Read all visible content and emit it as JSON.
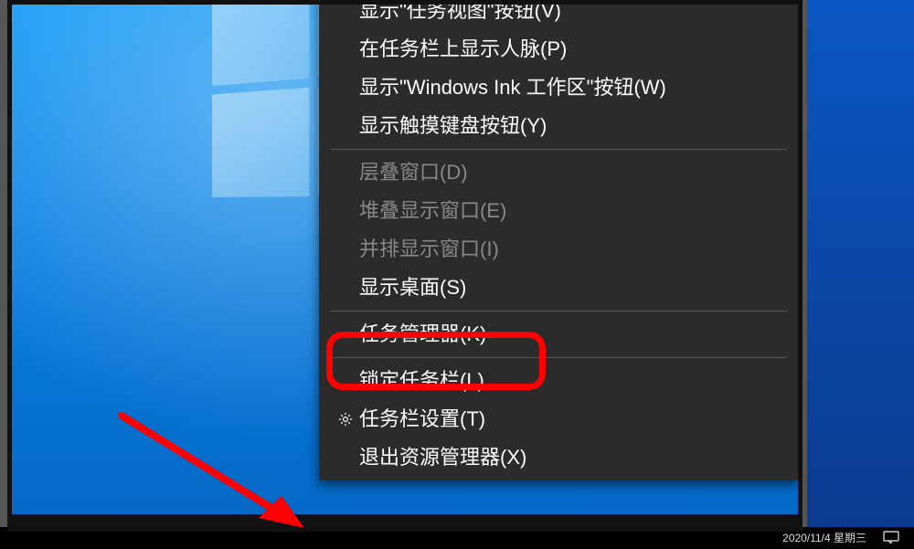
{
  "context_menu": {
    "groups": [
      {
        "items": [
          {
            "label": "显示\"任务视图\"按钮(V)",
            "disabled": false,
            "icon": null
          },
          {
            "label": "在任务栏上显示人脉(P)",
            "disabled": false,
            "icon": null
          },
          {
            "label": "显示\"Windows Ink 工作区\"按钮(W)",
            "disabled": false,
            "icon": null
          },
          {
            "label": "显示触摸键盘按钮(Y)",
            "disabled": false,
            "icon": null
          }
        ]
      },
      {
        "items": [
          {
            "label": "层叠窗口(D)",
            "disabled": true,
            "icon": null
          },
          {
            "label": "堆叠显示窗口(E)",
            "disabled": true,
            "icon": null
          },
          {
            "label": "并排显示窗口(I)",
            "disabled": true,
            "icon": null
          },
          {
            "label": "显示桌面(S)",
            "disabled": false,
            "icon": null
          }
        ]
      },
      {
        "items": [
          {
            "label": "任务管理器(K)",
            "disabled": false,
            "icon": null,
            "highlighted": true
          }
        ]
      },
      {
        "items": [
          {
            "label": "锁定任务栏(L)",
            "disabled": false,
            "icon": null
          },
          {
            "label": "任务栏设置(T)",
            "disabled": false,
            "icon": "gear"
          },
          {
            "label": "退出资源管理器(X)",
            "disabled": false,
            "icon": null
          }
        ]
      }
    ]
  },
  "taskbar_clock": "2020/11/4 星期三"
}
